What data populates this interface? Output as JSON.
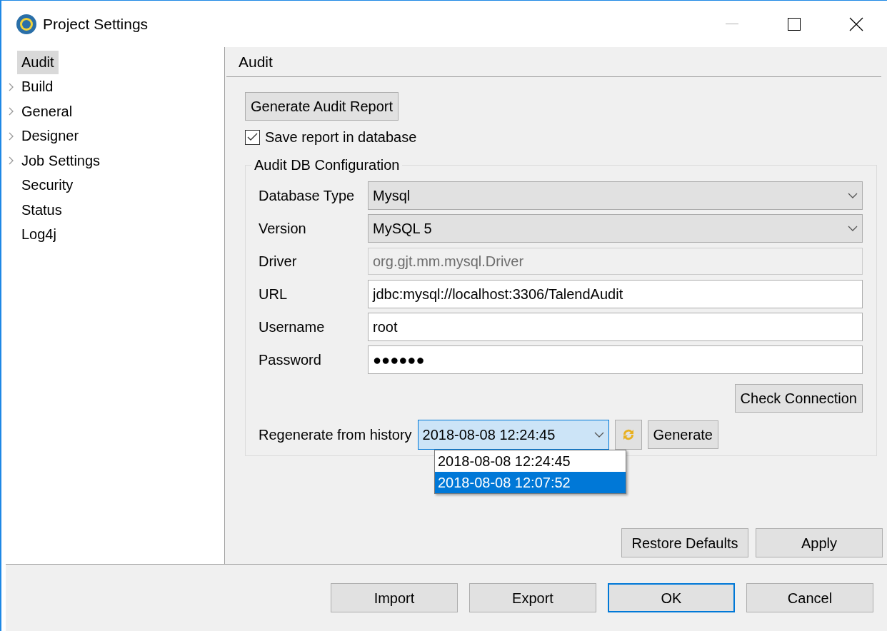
{
  "window": {
    "title": "Project Settings"
  },
  "sidebar": {
    "items": [
      {
        "label": "Audit",
        "expandable": false,
        "selected": true
      },
      {
        "label": "Build",
        "expandable": true,
        "selected": false
      },
      {
        "label": "General",
        "expandable": true,
        "selected": false
      },
      {
        "label": "Designer",
        "expandable": true,
        "selected": false
      },
      {
        "label": "Job Settings",
        "expandable": true,
        "selected": false
      },
      {
        "label": "Security",
        "expandable": false,
        "selected": false
      },
      {
        "label": "Status",
        "expandable": false,
        "selected": false
      },
      {
        "label": "Log4j",
        "expandable": false,
        "selected": false
      }
    ]
  },
  "page": {
    "title": "Audit",
    "generate_button": "Generate Audit Report",
    "save_checkbox": {
      "label": "Save report in database",
      "checked": true
    },
    "group": {
      "legend": "Audit DB Configuration",
      "fields": [
        {
          "label": "Database Type",
          "kind": "select",
          "value": "Mysql"
        },
        {
          "label": "Version",
          "kind": "select",
          "value": "MySQL 5"
        },
        {
          "label": "Driver",
          "kind": "text",
          "value": "org.gjt.mm.mysql.Driver",
          "disabled": true
        },
        {
          "label": "URL",
          "kind": "text",
          "value": "jdbc:mysql://localhost:3306/TalendAudit",
          "disabled": false
        },
        {
          "label": "Username",
          "kind": "text",
          "value": "root",
          "disabled": false
        },
        {
          "label": "Password",
          "kind": "text",
          "value": "●●●●●●",
          "disabled": false
        }
      ],
      "check_button": "Check Connection",
      "history": {
        "label": "Regenerate from history",
        "value": "2018-08-08 12:24:45",
        "expanded": true,
        "options": [
          {
            "label": "2018-08-08 12:24:45",
            "highlighted": false
          },
          {
            "label": "2018-08-08 12:07:52",
            "highlighted": true
          }
        ]
      },
      "generate_history_button": "Generate"
    },
    "buttons": [
      "Restore Defaults",
      "Apply"
    ]
  },
  "footer": {
    "buttons": [
      {
        "label": "Import",
        "default": false
      },
      {
        "label": "Export",
        "default": false
      },
      {
        "label": "OK",
        "default": true
      },
      {
        "label": "Cancel",
        "default": false
      }
    ]
  }
}
